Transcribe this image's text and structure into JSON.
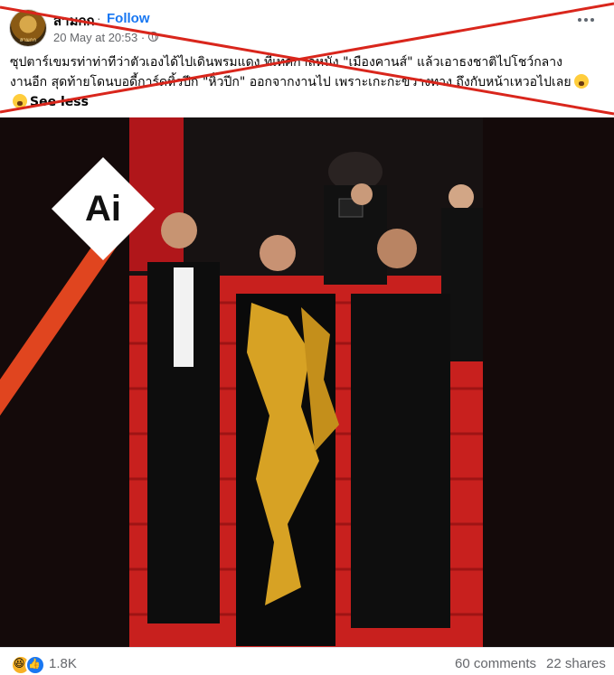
{
  "post": {
    "author": "สามกก",
    "separator": "·",
    "follow_label": "Follow",
    "timestamp": "20 May at 20:53 ·",
    "caption_line1": "ซุปตาร์เขมรท่าท่าทีว่าตัวเองได้ไปเดินพรมแดง ที่เทศกาลหนัง \"เมืองคานส์\" แล้วเอาธงชาติไปโชว์กลาง",
    "caption_line2": "งานอีก สุดท้ายโดนบอดี้การ์ดหิ้วปีก \"หิ้วปีก\" ออกจากงานไป เพราะเกะกะขวางทาง ถึงกับหน้าเหวอไปเลย",
    "see_less_label": "See less",
    "avatar_text": "สามกก"
  },
  "photo": {
    "badge_text": "Ai",
    "stripe_color": "#e0451f"
  },
  "footer": {
    "reaction_count": "1.8K",
    "comments_label": "60 comments",
    "shares_label": "22 shares"
  },
  "colors": {
    "cross": "#d9261c",
    "link": "#1877f2",
    "carpet": "#c8201e"
  }
}
